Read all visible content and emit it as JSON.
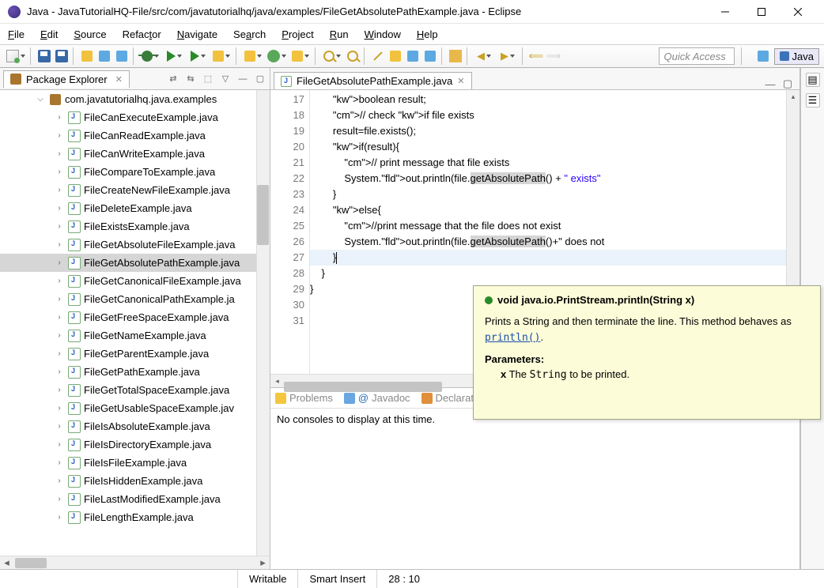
{
  "window": {
    "title": "Java - JavaTutorialHQ-File/src/com/javatutorialhq/java/examples/FileGetAbsolutePathExample.java - Eclipse"
  },
  "menu": [
    "File",
    "Edit",
    "Source",
    "Refactor",
    "Navigate",
    "Search",
    "Project",
    "Run",
    "Window",
    "Help"
  ],
  "toolbar": {
    "quick_access_placeholder": "Quick Access",
    "perspective_label": "Java"
  },
  "package_explorer": {
    "title": "Package Explorer",
    "package": "com.javatutorialhq.java.examples",
    "files": [
      "FileCanExecuteExample.java",
      "FileCanReadExample.java",
      "FileCanWriteExample.java",
      "FileCompareToExample.java",
      "FileCreateNewFileExample.java",
      "FileDeleteExample.java",
      "FileExistsExample.java",
      "FileGetAbsoluteFileExample.java",
      "FileGetAbsolutePathExample.java",
      "FileGetCanonicalFileExample.java",
      "FileGetCanonicalPathExample.ja",
      "FileGetFreeSpaceExample.java",
      "FileGetNameExample.java",
      "FileGetParentExample.java",
      "FileGetPathExample.java",
      "FileGetTotalSpaceExample.java",
      "FileGetUsableSpaceExample.jav",
      "FileIsAbsoluteExample.java",
      "FileIsDirectoryExample.java",
      "FileIsFileExample.java",
      "FileIsHiddenExample.java",
      "FileLastModifiedExample.java",
      "FileLengthExample.java"
    ],
    "selected_index": 8
  },
  "editor": {
    "tab_label": "FileGetAbsolutePathExample.java",
    "line_start": 17,
    "line_end": 31,
    "lines": [
      "",
      "        boolean result;",
      "        // check if file exists",
      "        result=file.exists();",
      "        if(result){",
      "            // print message that file exists",
      "            System.out.println(file.getAbsolutePath() + \" exists\"",
      "        }",
      "        else{",
      "            //print message that the file does not exist",
      "            System.out.println(file.getAbsolutePath()+\" does not ",
      "        }",
      "    }",
      "}",
      ""
    ]
  },
  "bottom_tabs": {
    "problems": "Problems",
    "javadoc": "Javadoc",
    "declaration": "Declarat",
    "console_msg": "No consoles to display at this time."
  },
  "tooltip": {
    "signature": "void java.io.PrintStream.println(String x)",
    "body": "Prints a String and then terminate the line. This method behaves as",
    "link": "println()",
    "params_heading": "Parameters:",
    "param_name": "x",
    "param_desc_prefix": " The ",
    "param_desc_code": "String",
    "param_desc_suffix": " to be printed."
  },
  "status": {
    "writable": "Writable",
    "mode": "Smart Insert",
    "position": "28 : 10"
  }
}
